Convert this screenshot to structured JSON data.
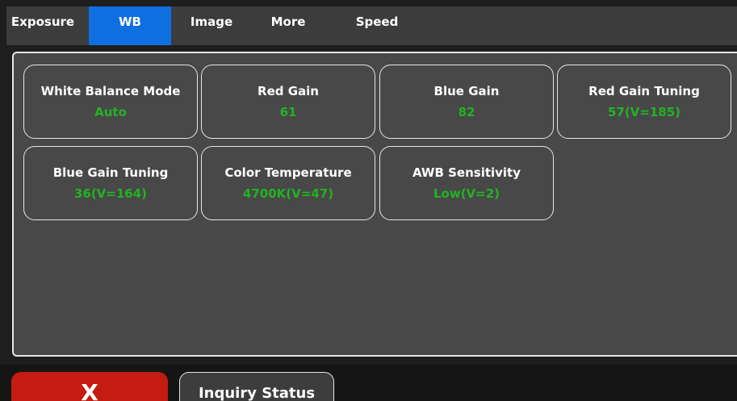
{
  "tabs": [
    {
      "label": "Exposure"
    },
    {
      "label": "WB"
    },
    {
      "label": "Image"
    },
    {
      "label": "More"
    },
    {
      "label": "Speed"
    }
  ],
  "active_tab": "WB",
  "settings": [
    {
      "label": "White Balance Mode",
      "value": "Auto"
    },
    {
      "label": "Red Gain",
      "value": "61"
    },
    {
      "label": "Blue Gain",
      "value": "82"
    },
    {
      "label": "Red Gain Tuning",
      "value": "57(V=185)"
    },
    {
      "label": "Blue Gain Tuning",
      "value": "36(V=164)"
    },
    {
      "label": "Color Temperature",
      "value": "4700K(V=47)"
    },
    {
      "label": "AWB Sensitivity",
      "value": "Low(V=2)"
    }
  ],
  "bottom": {
    "close_label": "X",
    "inquiry_label": "Inquiry Status"
  },
  "colors": {
    "active_tab": "#0f6fe0",
    "value_text": "#22b322",
    "close_button": "#c41c10",
    "panel": "#484848",
    "topbar": "#3c3c3c"
  }
}
